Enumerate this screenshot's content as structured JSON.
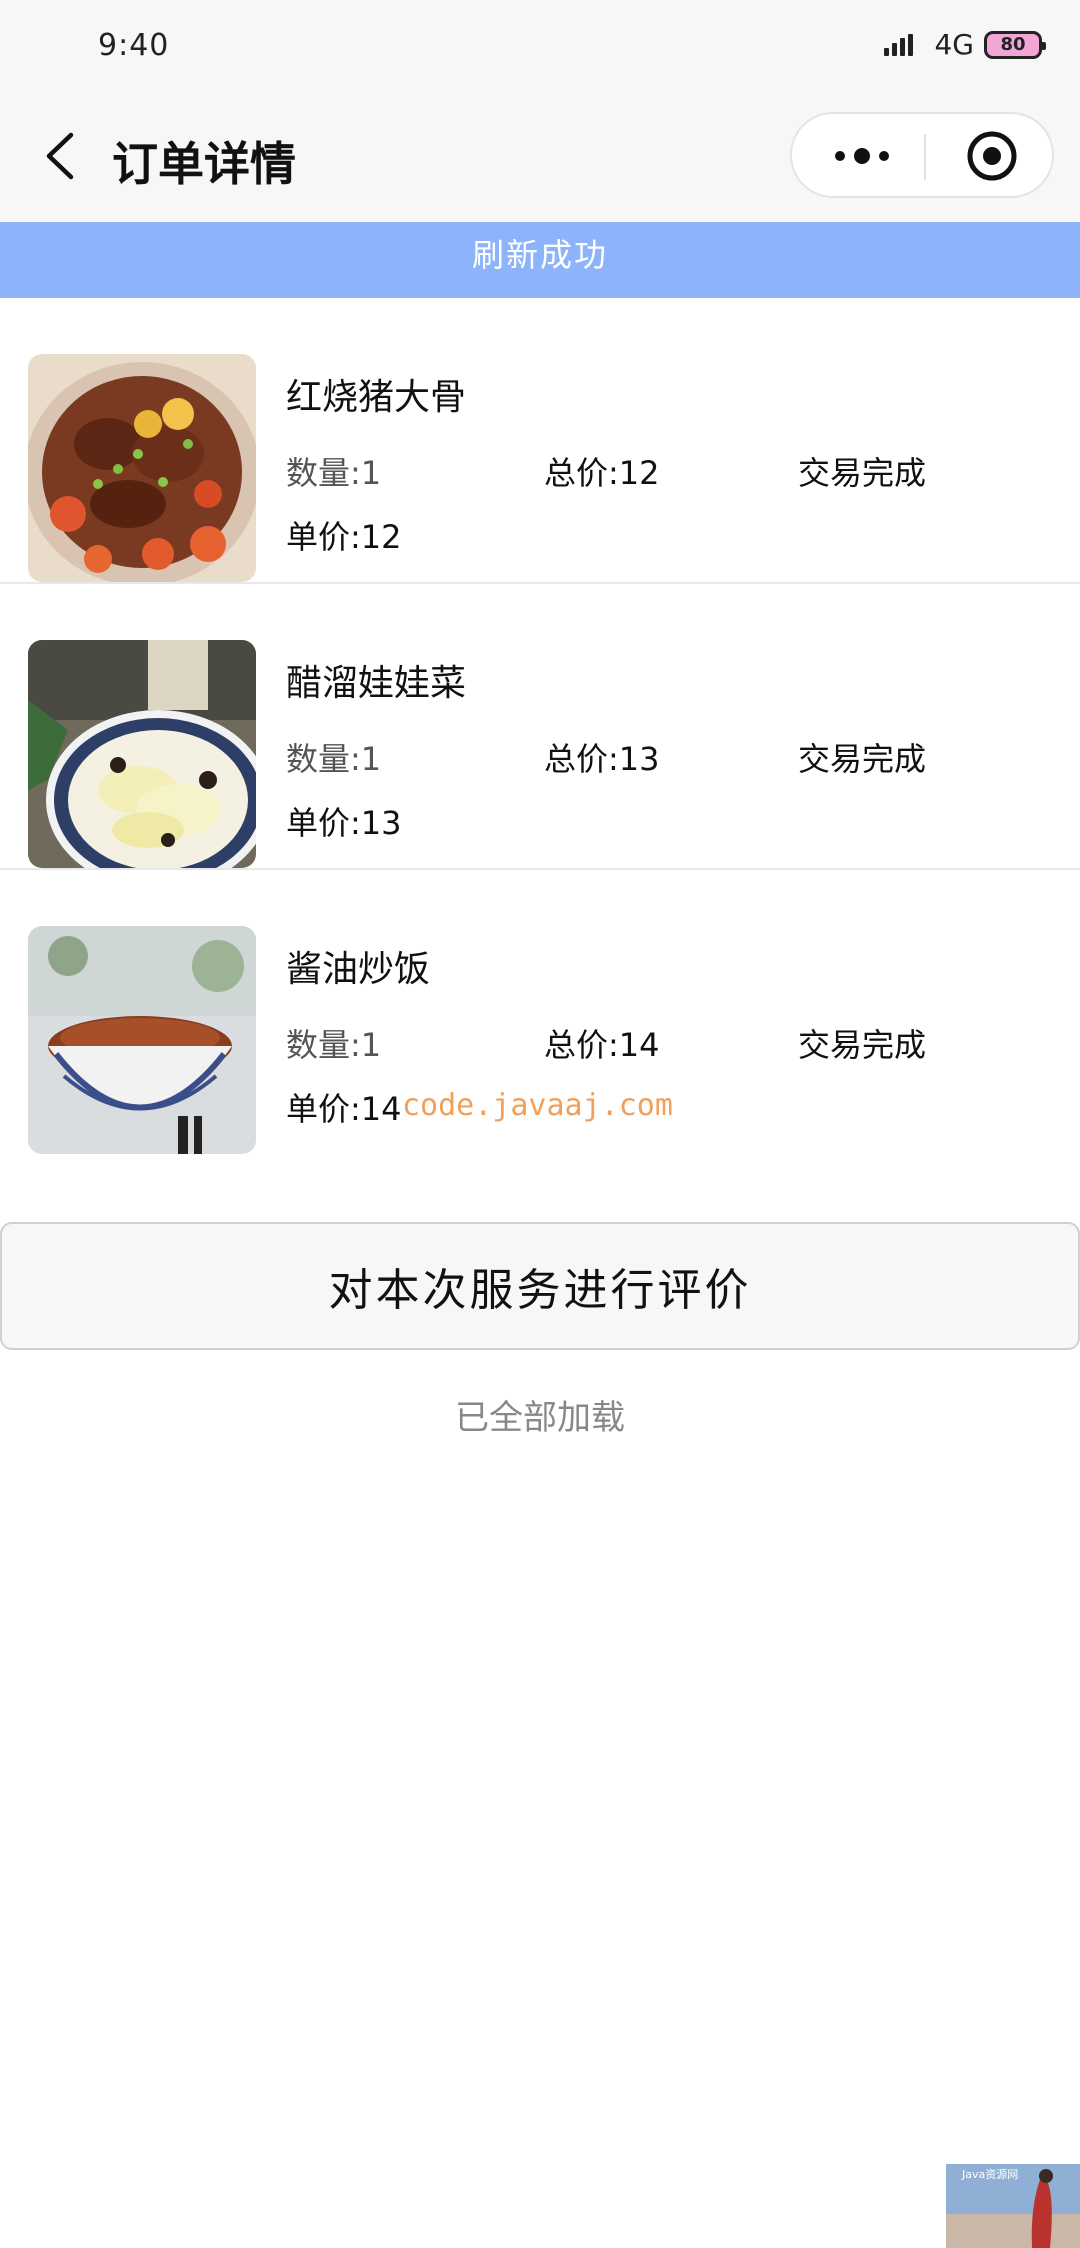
{
  "status_bar": {
    "time": "9:40",
    "network": "4G",
    "battery": "80",
    "icons": [
      "signal-icon",
      "battery-icon"
    ]
  },
  "nav": {
    "title": "订单详情",
    "icons": [
      "back-icon",
      "more-dots-icon",
      "close-target-icon"
    ]
  },
  "banner": {
    "text": "刷新成功",
    "color": "#8db3fb"
  },
  "orders": [
    {
      "name": "红烧猪大骨",
      "qty_label": "数量:1",
      "total_label": "总价:12",
      "status": "交易完成",
      "unit_label": "单价:12"
    },
    {
      "name": "醋溜娃娃菜",
      "qty_label": "数量:1",
      "total_label": "总价:13",
      "status": "交易完成",
      "unit_label": "单价:13"
    },
    {
      "name": "酱油炒饭",
      "qty_label": "数量:1",
      "total_label": "总价:14",
      "status": "交易完成",
      "unit_label": "单价:14"
    }
  ],
  "watermark": "code.javaaj.com",
  "review_button": "对本次服务进行评价",
  "loaded_text": "已全部加载",
  "corner_watermark": "Java资源网"
}
